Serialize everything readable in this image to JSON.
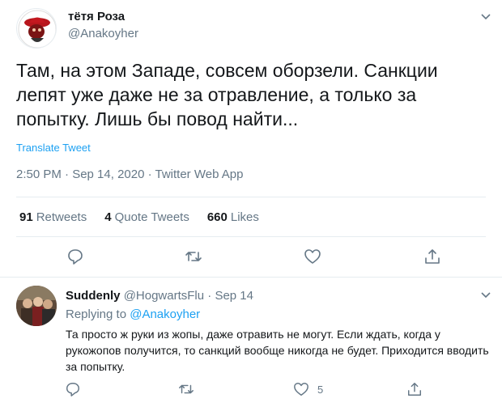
{
  "tweet": {
    "author_name": "тётя Роза",
    "author_handle": "@Anakoyher",
    "text": "Там, на этом Западе, совсем оборзели. Санкции лепят уже даже не за отравление, а только за попытку. Лишь бы повод найти...",
    "translate_label": "Translate Tweet",
    "meta": "2:50 PM · Sep 14, 2020 · Twitter Web App",
    "stats": {
      "retweets_count": "91",
      "retweets_label": "Retweets",
      "quotes_count": "4",
      "quotes_label": "Quote Tweets",
      "likes_count": "660",
      "likes_label": "Likes"
    },
    "actions": [
      "reply-icon",
      "retweet-icon",
      "like-icon",
      "share-icon"
    ]
  },
  "reply": {
    "author_name": "Suddenly",
    "author_handle": "@HogwartsFlu",
    "date": "· Sep 14",
    "replying_prefix": "Replying to",
    "replying_handle": "@Anakoyher",
    "text": "Та просто ж руки из жопы, даже отравить не могут. Если ждать, когда у рукожопов получится, то санкций вообще никогда не будет. Приходится вводить за попытку.",
    "like_count": "5"
  },
  "colors": {
    "accent": "#1da1f2",
    "secondary_text": "#657786",
    "primary_text": "#14171a",
    "divider": "#e6ecf0"
  }
}
